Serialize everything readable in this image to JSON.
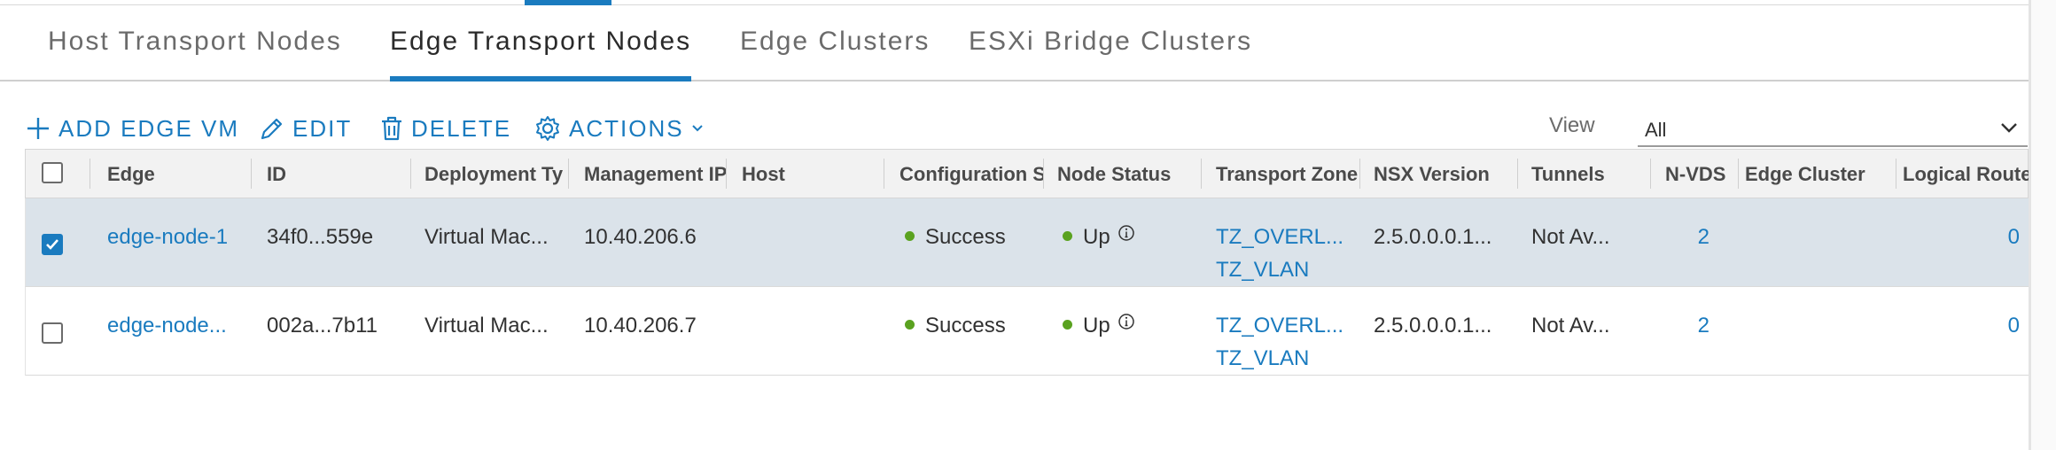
{
  "tabs": [
    {
      "label": "Host Transport Nodes",
      "active": false
    },
    {
      "label": "Edge Transport Nodes",
      "active": true
    },
    {
      "label": "Edge Clusters",
      "active": false
    },
    {
      "label": "ESXi Bridge Clusters",
      "active": false
    }
  ],
  "toolbar": {
    "add_label": "ADD EDGE VM",
    "edit_label": "EDIT",
    "delete_label": "DELETE",
    "actions_label": "ACTIONS",
    "view_label": "View",
    "view_value": "All"
  },
  "columns": [
    "Edge",
    "ID",
    "Deployment Ty",
    "Management IP",
    "Host",
    "Configuration S",
    "Node Status",
    "Transport Zone",
    "NSX Version",
    "Tunnels",
    "N-VDS",
    "Edge Cluster",
    "Logical Routers"
  ],
  "rows": [
    {
      "selected": true,
      "edge": "edge-node-1",
      "id": "34f0...559e",
      "deployment": "Virtual Mac...",
      "mgmt_ip": "10.40.206.6",
      "host": "",
      "config_status": "Success",
      "node_status": "Up",
      "transport_zone_1": "TZ_OVERL...",
      "transport_zone_2": "TZ_VLAN",
      "nsx_version": "2.5.0.0.0.1...",
      "tunnels": "Not Av...",
      "nvds": "2",
      "edge_cluster": "",
      "logical_routers": "0"
    },
    {
      "selected": false,
      "edge": "edge-node...",
      "id": "002a...7b11",
      "deployment": "Virtual Mac...",
      "mgmt_ip": "10.40.206.7",
      "host": "",
      "config_status": "Success",
      "node_status": "Up",
      "transport_zone_1": "TZ_OVERL...",
      "transport_zone_2": "TZ_VLAN",
      "nsx_version": "2.5.0.0.0.1...",
      "tunnels": "Not Av...",
      "nvds": "2",
      "edge_cluster": "",
      "logical_routers": "0"
    }
  ],
  "colors": {
    "accent": "#1a7bbf",
    "success_dot": "#5aa220",
    "selected_row": "#dbe3ea"
  },
  "icons": [
    "plus-icon",
    "pencil-icon",
    "trash-icon",
    "gear-icon",
    "chevron-down-icon",
    "info-icon",
    "checkmark-icon"
  ]
}
